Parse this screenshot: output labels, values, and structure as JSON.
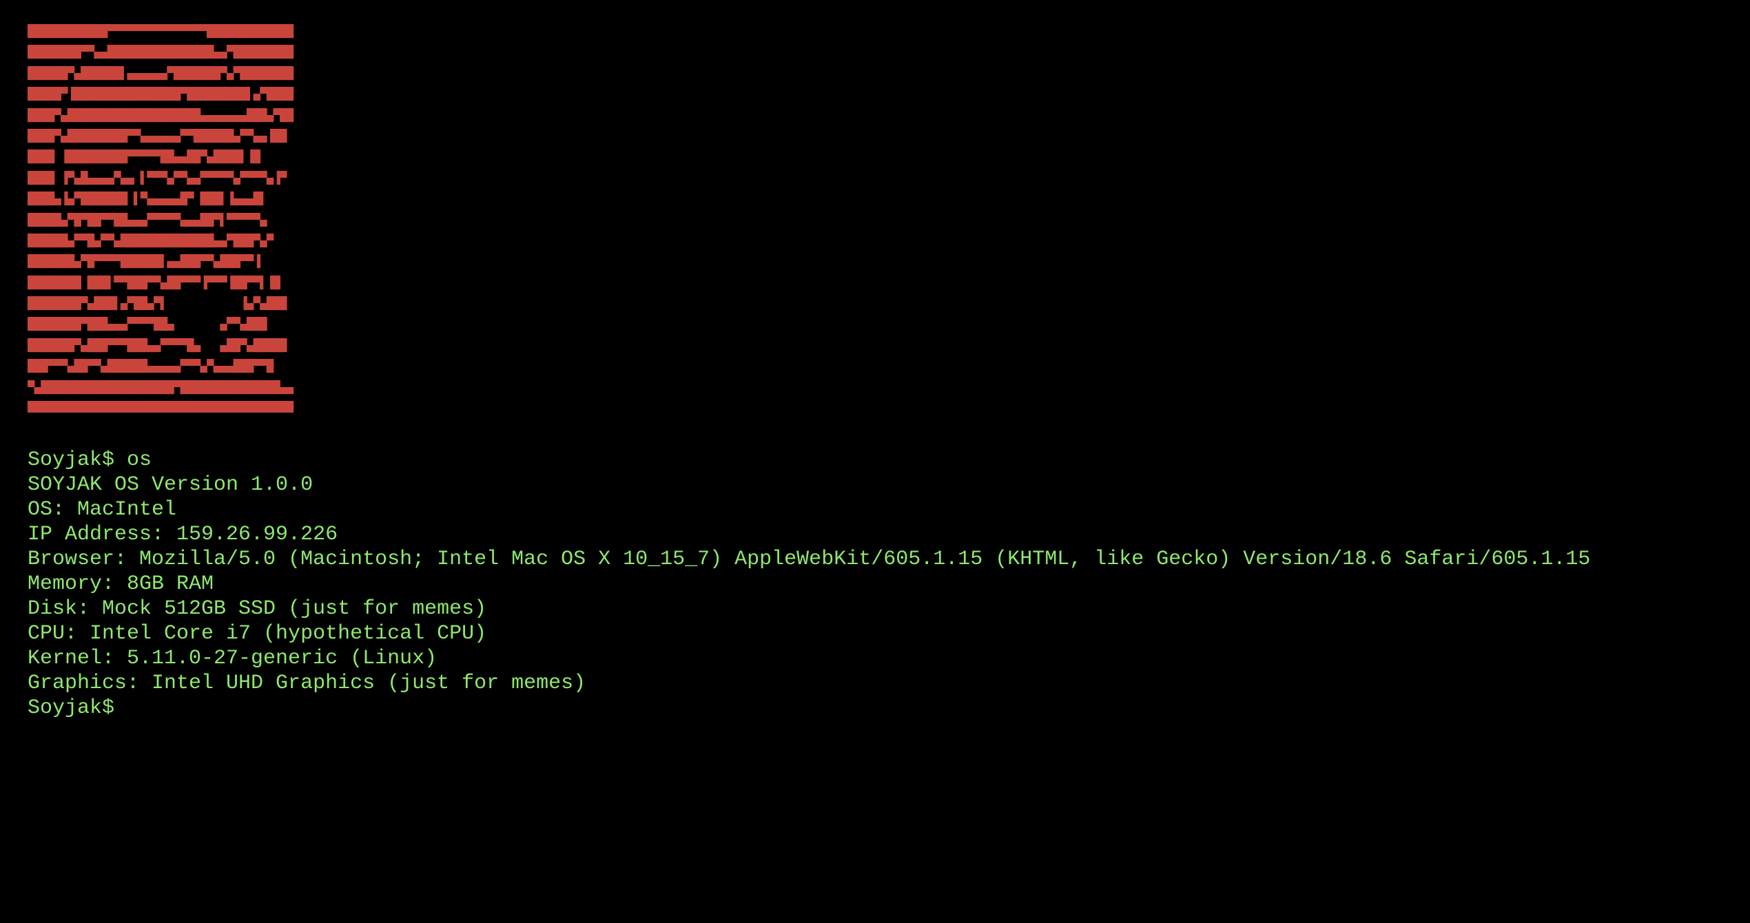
{
  "colors": {
    "background": "#000000",
    "ascii_art": "#c9453c",
    "text": "#8ee86e"
  },
  "ascii_art": {
    "rows": [
      "████████████▀▀▀▀▀▀▀▀▀▀▀▀▀▀▀█████████████",
      "████████▀▀▄▄████████████████▄▄▀█████████",
      "██████▀▄██████▌▄▄▄▄▄▄▀███████▀▄▀████████",
      "█████▀▐████████████████▀█████████▌▄▀████",
      "████▀▄████████████████████▄▄▄▄▄▄▄███▄▀██",
      "████▀▄█████████▀▀▄▄▄▄▄▄▀▀██████▄▀▀▄▄▐██",
      "████ ▐█████████▀▀▀▀▀██▄▄██▀▄████▌▐█",
      "████ ▐▀▄█▄▄▄▄▀▄▄ ▌▀▀▀▄▀▀▄▄▀▀▀▀▀▄▀▀▀▀▄▐▀",
      "████▄▐▄▀███████ ▌▀▄▄▄▄▄█▀ ███▌▐▄▄▄█▌",
      "█████▄▀█▀██▀▀██▄▄▄▀▀▀▀▀▄▄▄██▀▌▀▀▀▀▀▄",
      "██████▄▀▀█▄▀▀▄██████████████▄▄▀███▀▄▀",
      "███████▄▀█▀▀▀▀██████▌▄▄███▀▀▄███▀▀▐",
      "████████ ███▌▀▀███▀▀▄██▀▀▀▐▀▀▀▐██▀▀▌▐█",
      "████████▀▄███▌▄▀██▄▀▌           ▐▄▀▄███",
      "████████▀███▄▄▄▀▀▀▀██▄       ▄▀▀▄███",
      "███████▀▄███▀▀▀███▄▄▀▀▀▀█▄   ▄██▀▄█████",
      "███▀▀▀▄██▀▀▄██████▄▄▄▄▄▀▀▀▄▀▄▄▄███▀▀█",
      "▀▄████████████████████▀███████████████▄▄",
      "████████████████████████████████████████"
    ]
  },
  "terminal": {
    "lines": [
      "Soyjak$ os",
      "SOYJAK OS Version 1.0.0",
      "OS: MacIntel",
      "IP Address: 159.26.99.226",
      "Browser: Mozilla/5.0 (Macintosh; Intel Mac OS X 10_15_7) AppleWebKit/605.1.15 (KHTML, like Gecko) Version/18.6 Safari/605.1.15",
      "Memory: 8GB RAM",
      "Disk: Mock 512GB SSD (just for memes)",
      "CPU: Intel Core i7 (hypothetical CPU)",
      "Kernel: 5.11.0-27-generic (Linux)",
      "Graphics: Intel UHD Graphics (just for memes)"
    ],
    "prompt": "Soyjak$",
    "input_value": ""
  }
}
